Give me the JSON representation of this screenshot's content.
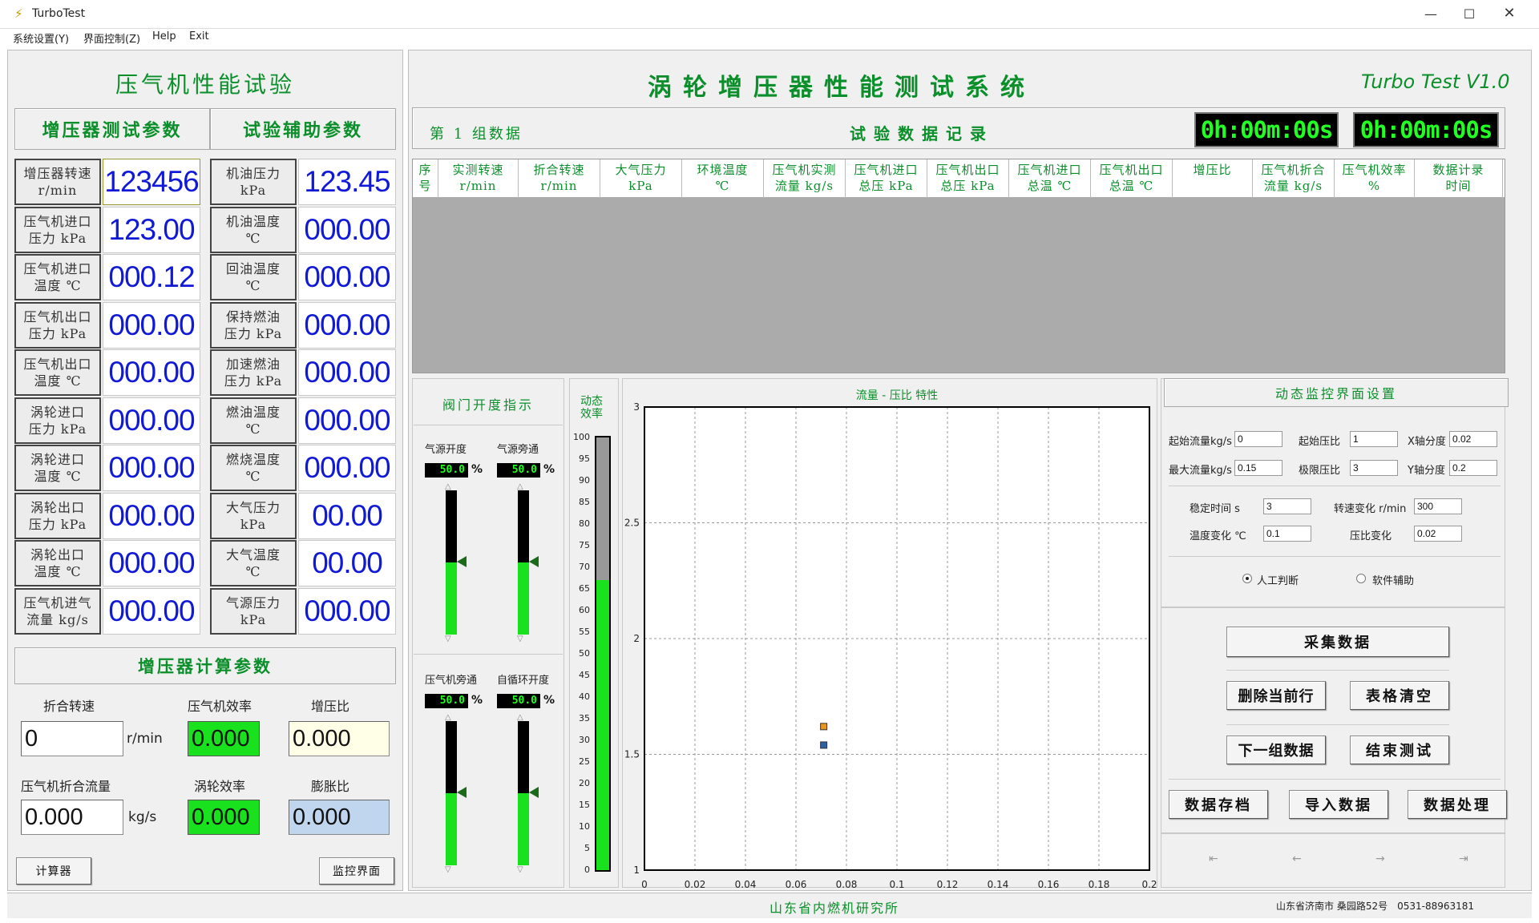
{
  "window": {
    "title": "TurboTest"
  },
  "menu": [
    "系统设置(Y)",
    "界面控制(Z)",
    "Help",
    "Exit"
  ],
  "left": {
    "heading": "压气机性能试验",
    "col1_header": "增压器测试参数",
    "col2_header": "试验辅助参数",
    "params": [
      {
        "l1": "增压器转速",
        "l2": "r/min",
        "v1": "123456",
        "a1": "机油压力",
        "a2": "kPa",
        "av": "123.45"
      },
      {
        "l1": "压气机进口",
        "l2": "压力 kPa",
        "v1": "123.00",
        "a1": "机油温度",
        "a2": "℃",
        "av": "000.00"
      },
      {
        "l1": "压气机进口",
        "l2": "温度 ℃",
        "v1": "000.12",
        "a1": "回油温度",
        "a2": "℃",
        "av": "000.00"
      },
      {
        "l1": "压气机出口",
        "l2": "压力 kPa",
        "v1": "000.00",
        "a1": "保持燃油",
        "a2": "压力 kPa",
        "av": "000.00"
      },
      {
        "l1": "压气机出口",
        "l2": "温度 ℃",
        "v1": "000.00",
        "a1": "加速燃油",
        "a2": "压力 kPa",
        "av": "000.00"
      },
      {
        "l1": "涡轮进口",
        "l2": "压力 kPa",
        "v1": "000.00",
        "a1": "燃油温度",
        "a2": "℃",
        "av": "000.00"
      },
      {
        "l1": "涡轮进口",
        "l2": "温度 ℃",
        "v1": "000.00",
        "a1": "燃烧温度",
        "a2": "℃",
        "av": "000.00"
      },
      {
        "l1": "涡轮出口",
        "l2": "压力 kPa",
        "v1": "000.00",
        "a1": "大气压力",
        "a2": "kPa",
        "av": "00.00"
      },
      {
        "l1": "涡轮出口",
        "l2": "温度 ℃",
        "v1": "000.00",
        "a1": "大气温度",
        "a2": "℃",
        "av": "00.00"
      },
      {
        "l1": "压气机进气",
        "l2": "流量 kg/s",
        "v1": "000.00",
        "a1": "气源压力",
        "a2": "kPa",
        "av": "000.00"
      }
    ],
    "calc_heading": "增压器计算参数",
    "calc": {
      "speed_label": "折合转速",
      "speed_value": "0",
      "speed_unit": "r/min",
      "comp_eff_label": "压气机效率",
      "comp_eff_value": "0.000",
      "pr_label": "增压比",
      "pr_value": "0.000",
      "flow_label": "压气机折合流量",
      "flow_value": "0.000",
      "flow_unit": "kg/s",
      "turb_eff_label": "涡轮效率",
      "turb_eff_value": "0.000",
      "exp_label": "膨胀比",
      "exp_value": "0.000"
    },
    "calculator_button": "计算器",
    "monitor_button": "监控界面"
  },
  "main": {
    "title": "涡轮增压器性能测试系统",
    "version": "Turbo Test V1.0",
    "group_label": "第 1 组数据",
    "record_title": "试验数据记录",
    "timer1": "0h:00m:00s",
    "timer2": "0h:00m:00s",
    "table_headers": [
      [
        "序号",
        ""
      ],
      [
        "实测转速",
        "r/min"
      ],
      [
        "折合转速",
        "r/min"
      ],
      [
        "大气压力",
        "kPa"
      ],
      [
        "环境温度",
        "℃"
      ],
      [
        "压气机实测",
        "流量 kg/s"
      ],
      [
        "压气机进口",
        "总压 kPa"
      ],
      [
        "压气机出口",
        "总压 kPa"
      ],
      [
        "压气机进口",
        "总温 ℃"
      ],
      [
        "压气机出口",
        "总温 ℃"
      ],
      [
        "增压比",
        ""
      ],
      [
        "压气机折合",
        "流量 kg/s"
      ],
      [
        "压气机效率",
        "%"
      ],
      [
        "数据计录",
        "时间"
      ]
    ]
  },
  "valves": {
    "heading": "阀门开度指示",
    "items": [
      {
        "label": "气源开度",
        "value": "50.0",
        "level": 0.5
      },
      {
        "label": "气源旁通",
        "value": "50.0",
        "level": 0.5
      },
      {
        "label": "压气机旁通",
        "value": "50.0",
        "level": 0.5
      },
      {
        "label": "自循环开度",
        "value": "50.0",
        "level": 0.5
      }
    ],
    "unit": "%"
  },
  "efficiency": {
    "heading_1": "动态",
    "heading_2": "效率",
    "scale": [
      "100",
      "95",
      "90",
      "85",
      "80",
      "75",
      "70",
      "65",
      "60",
      "55",
      "50",
      "45",
      "40",
      "35",
      "30",
      "25",
      "20",
      "15",
      "10",
      "5",
      "0"
    ],
    "level": 0.67
  },
  "chart_data": {
    "type": "scatter",
    "title": "流量 - 压比 特性",
    "xlim": [
      0,
      0.2
    ],
    "ylim": [
      1,
      3
    ],
    "x_ticks": [
      "0",
      "0.02",
      "0.04",
      "0.06",
      "0.08",
      "0.1",
      "0.12",
      "0.14",
      "0.16",
      "0.18",
      "0.2"
    ],
    "y_ticks": [
      {
        "v": 1,
        "t": "1"
      },
      {
        "v": 1.5,
        "t": "1.5"
      },
      {
        "v": 2,
        "t": "2"
      },
      {
        "v": 2.5,
        "t": "2.5"
      },
      {
        "v": 3,
        "t": "3"
      }
    ],
    "grid": true,
    "points": [
      {
        "x": 0.071,
        "y": 1.62,
        "color": "#e8961e"
      },
      {
        "x": 0.071,
        "y": 1.54,
        "color": "#2f5f9e"
      }
    ]
  },
  "monitor": {
    "heading": "动态监控界面设置",
    "fields": [
      {
        "label": "起始流量kg/s",
        "value": "0"
      },
      {
        "label": "起始压比",
        "value": "1"
      },
      {
        "label": "X轴分度",
        "value": "0.02"
      },
      {
        "label": "最大流量kg/s",
        "value": "0.15"
      },
      {
        "label": "极限压比",
        "value": "3"
      },
      {
        "label": "Y轴分度",
        "value": "0.2"
      },
      {
        "label": "稳定时间 s",
        "value": "3"
      },
      {
        "label": "转速变化 r/min",
        "value": "300"
      },
      {
        "label": "温度变化 ℃",
        "value": "0.1"
      },
      {
        "label": "压比变化",
        "value": "0.02"
      }
    ],
    "radio_manual": "人工判断",
    "radio_soft": "软件辅助"
  },
  "actions": {
    "collect": "采集数据",
    "delete_row": "删除当前行",
    "clear_table": "表格清空",
    "next_group": "下一组数据",
    "end_test": "结束测试",
    "save": "数据存档",
    "import": "导入数据",
    "process": "数据处理"
  },
  "status": {
    "center": "山东省内燃机研究所",
    "right": "山东省济南市 桑园路52号　0531-88963181"
  },
  "colors": {
    "accent_green": "#0b8f2a",
    "value_blue": "#1019d8",
    "led_green": "#22ff22",
    "bar_green": "#19e11e"
  }
}
